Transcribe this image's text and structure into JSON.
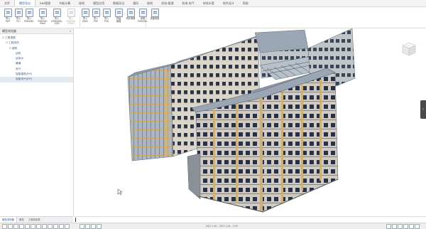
{
  "app": {
    "tabs": [
      "文件",
      "模型导出",
      "BIM管理",
      "节能计算",
      "结构",
      "模型应用",
      "数据导出",
      "通风",
      "结构",
      "机电·暖通",
      "机电·电气",
      "给排水管",
      "软件设计",
      "帮助"
    ],
    "active_tab_index": 1
  },
  "ribbon": {
    "buttons": [
      {
        "label": "导入\nSKP",
        "dim": false
      },
      {
        "label": "导入\nIFC",
        "dim": false
      },
      {
        "label": "导入\nPMODEL",
        "dim": false
      },
      {
        "label": "导入PMODEL\nRevit",
        "dim": false
      },
      {
        "label": "导入UPMODEL\nDGN",
        "dim": false
      },
      {
        "label": "导入PMODEL\nPDMS",
        "dim": true
      },
      {
        "label": "导入\nDWG",
        "dim": false
      },
      {
        "label": "导入\nPM*",
        "dim": false
      },
      {
        "label": "导入\nP3D",
        "dim": false
      },
      {
        "label": "构建\n管理",
        "dim": false
      },
      {
        "label": "构件管理",
        "dim": false
      },
      {
        "label": "参照\nPMODEL",
        "dim": false
      },
      {
        "label": "视图参照",
        "dim": false
      }
    ],
    "group_left": "导入",
    "group_right": "链接参照"
  },
  "sidebar": {
    "title": "模型浏览器",
    "close_glyph": "×",
    "tree": [
      {
        "label": "工程视图",
        "level": 0,
        "expander": "⊟"
      },
      {
        "label": "工程选项",
        "level": 1,
        "expander": "⊟"
      },
      {
        "label": "建筑",
        "level": 2,
        "expander": "⊟"
      },
      {
        "label": "结构",
        "level": 3,
        "expander": ""
      },
      {
        "label": "给排水",
        "level": 3,
        "expander": ""
      },
      {
        "label": "暖通",
        "level": 3,
        "expander": ""
      },
      {
        "label": "电气",
        "level": 3,
        "expander": ""
      },
      {
        "label": "智能建筑(PIP)",
        "level": 3,
        "expander": ""
      },
      {
        "label": "智能电气(PIP)",
        "level": 3,
        "expander": "",
        "selected": true
      }
    ],
    "footer_tabs": [
      "模型浏览器",
      "属性",
      "工程信息表"
    ]
  },
  "status": {
    "coords": "2017.1.26 -- 2017.1.26 -- 0.00"
  },
  "icons": [
    "nav-cube-icon",
    "side-panel-toggle-icon",
    "close-icon",
    "cursor-icon"
  ],
  "colors": {
    "active_tab": "#1a5fa8",
    "facade_light": "#d9d4cc",
    "roof": "#8d98a8",
    "window": "#2b3548",
    "panel_gray": "#9aa6b4"
  }
}
